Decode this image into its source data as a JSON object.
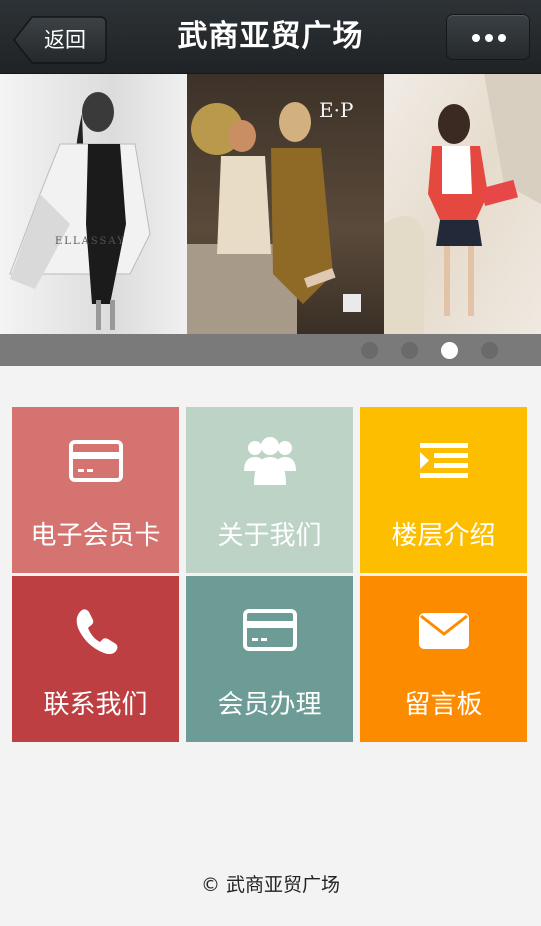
{
  "header": {
    "back_label": "返回",
    "title": "武商亚贸广场",
    "more_icon": "more-icon"
  },
  "banner": {
    "slides": [
      {
        "brand": "ELLASSAY"
      },
      {
        "brand": "E·P"
      },
      {
        "brand": ""
      }
    ],
    "pager": {
      "count": 4,
      "active_index": 2
    }
  },
  "menu": {
    "tiles": [
      {
        "label": "电子会员卡",
        "icon": "card-icon",
        "color": "#d47370"
      },
      {
        "label": "关于我们",
        "icon": "group-icon",
        "color": "#bcd3c6"
      },
      {
        "label": "楼层介绍",
        "icon": "list-icon",
        "color": "#fdbe00"
      },
      {
        "label": "联系我们",
        "icon": "phone-icon",
        "color": "#bd3f42"
      },
      {
        "label": "会员办理",
        "icon": "card-icon",
        "color": "#6c9c95"
      },
      {
        "label": "留言板",
        "icon": "mail-icon",
        "color": "#fd8b00"
      }
    ]
  },
  "footer": {
    "text": "© 武商亚贸广场"
  }
}
